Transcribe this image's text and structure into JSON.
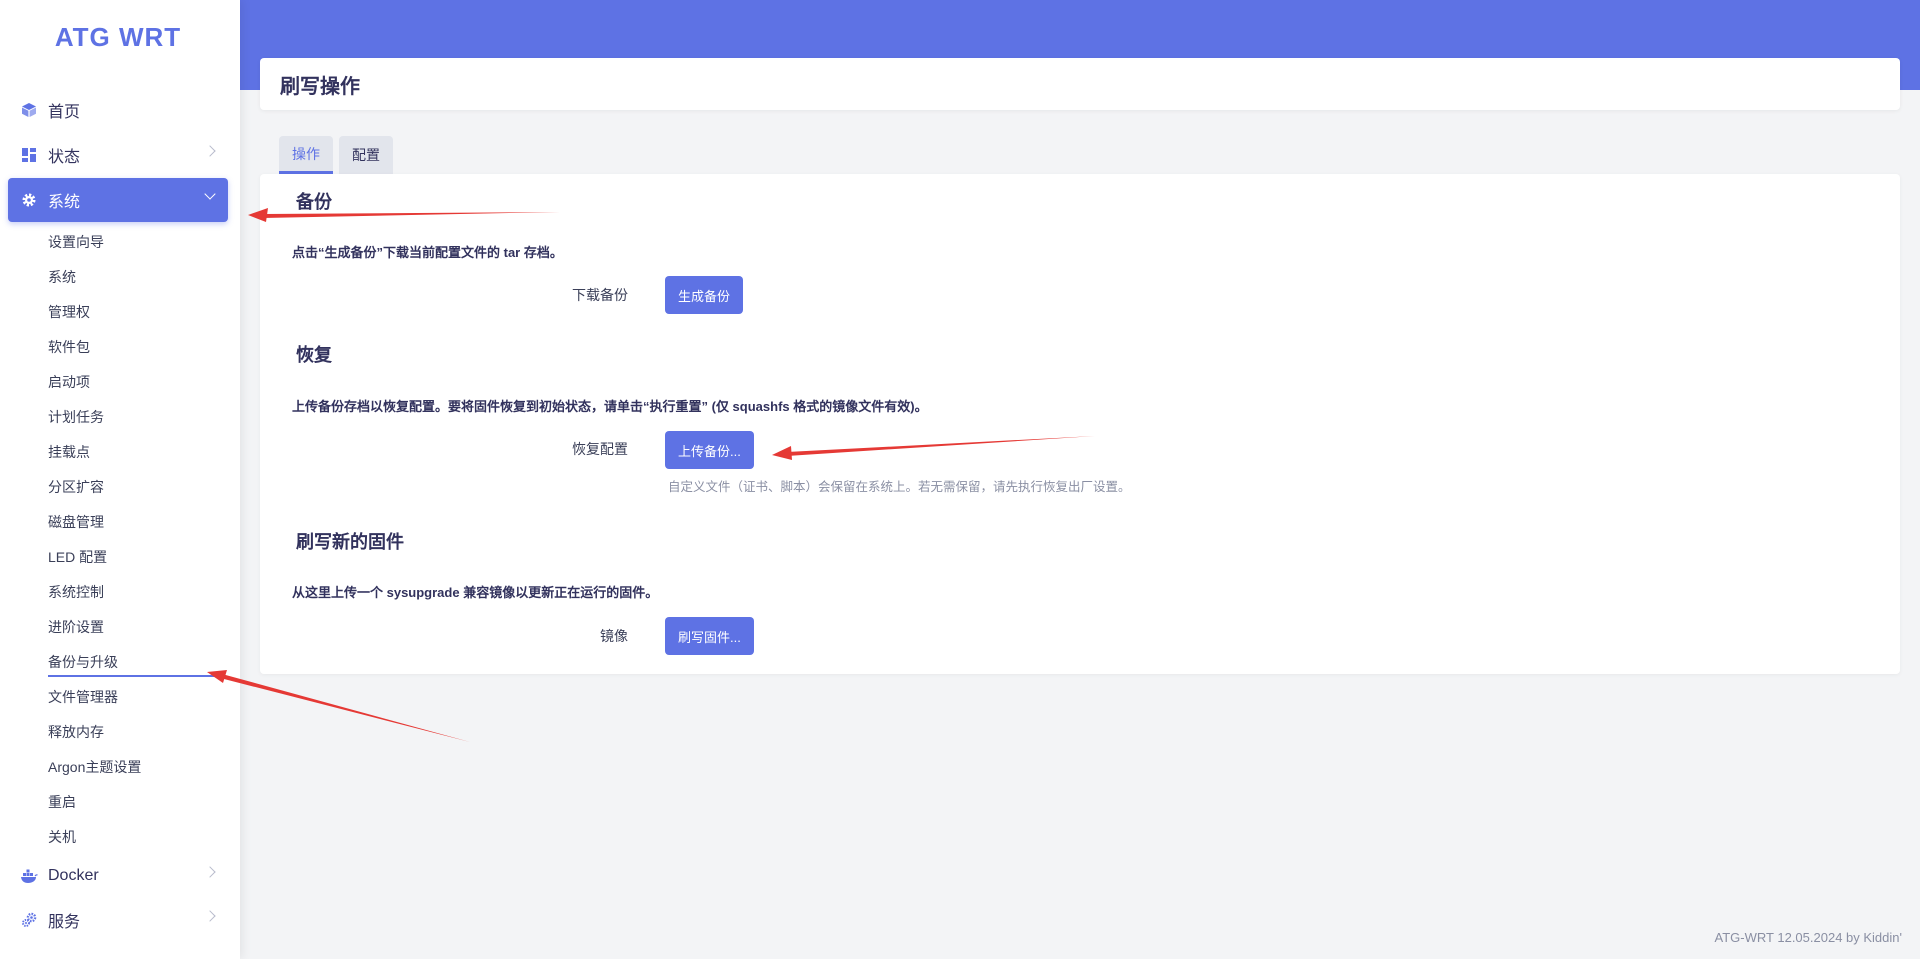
{
  "brand": "ATG WRT",
  "sidebar": {
    "home": {
      "label": "首页",
      "icon": "cube-icon"
    },
    "status": {
      "label": "状态",
      "icon": "dashboard-icon"
    },
    "system": {
      "label": "系统",
      "icon": "gear-icon"
    },
    "system_items": [
      "设置向导",
      "系统",
      "管理权",
      "软件包",
      "启动项",
      "计划任务",
      "挂载点",
      "分区扩容",
      "磁盘管理",
      "LED 配置",
      "系统控制",
      "进阶设置",
      "备份与升级",
      "文件管理器",
      "释放内存",
      "Argon主题设置",
      "重启",
      "关机"
    ],
    "current_item": "备份与升级",
    "docker": {
      "label": "Docker",
      "icon": "docker-whale-icon"
    },
    "services": {
      "label": "服务",
      "icon": "services-gears-icon"
    }
  },
  "page_title": "刷写操作",
  "tabs": [
    {
      "label": "操作",
      "active": true
    },
    {
      "label": "配置",
      "active": false
    }
  ],
  "backup": {
    "title": "备份",
    "desc": "点击“生成备份”下载当前配置文件的 tar 存档。",
    "row_label": "下载备份",
    "button": "生成备份"
  },
  "restore": {
    "title": "恢复",
    "desc": "上传备份存档以恢复配置。要将固件恢复到初始状态，请单击“执行重置” (仅 squashfs 格式的镜像文件有效)。",
    "row_label": "恢复配置",
    "button": "上传备份...",
    "hint": "自定义文件（证书、脚本）会保留在系统上。若无需保留，请先执行恢复出厂设置。"
  },
  "flash": {
    "title": "刷写新的固件",
    "desc": "从这里上传一个 sysupgrade 兼容镜像以更新正在运行的固件。",
    "row_label": "镜像",
    "button": "刷写固件..."
  },
  "footer": "ATG-WRT 12.05.2024 by Kiddin'",
  "colors": {
    "accent": "#5e72e4",
    "arrow": "#e53935"
  }
}
